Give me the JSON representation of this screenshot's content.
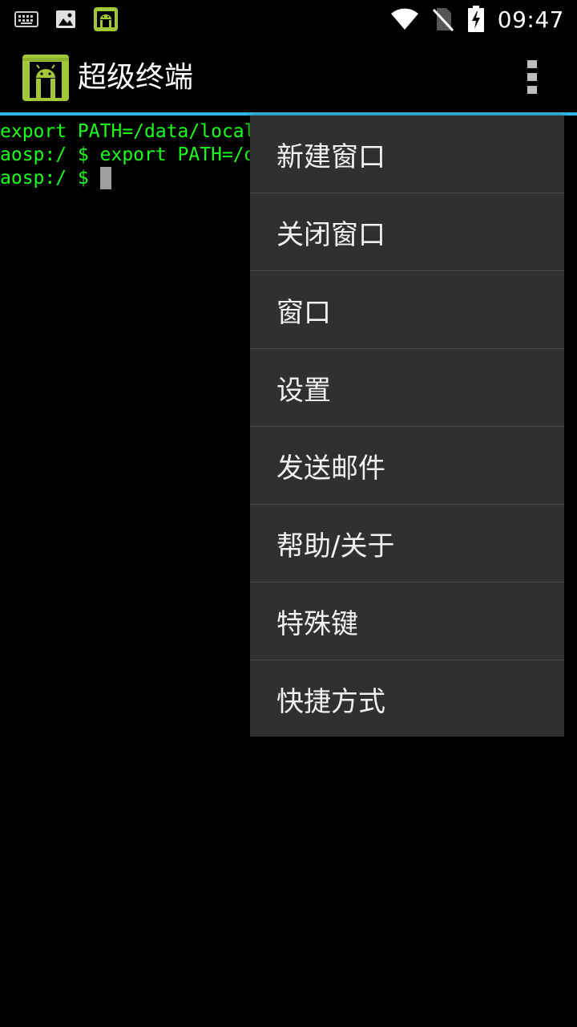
{
  "status_bar": {
    "time": "09:47",
    "left_icons": [
      "keyboard-icon",
      "image-icon",
      "android-notification-icon"
    ],
    "right_icons": [
      "wifi-icon",
      "no-sim-icon",
      "battery-charging-icon"
    ]
  },
  "action_bar": {
    "title": "超级终端",
    "overflow_icon": "overflow-menu-icon"
  },
  "terminal": {
    "lines": [
      "export PATH=/data/local",
      "aosp:/ $ export PATH=/d",
      "aosp:/ $ "
    ],
    "text_color": "#19ff19"
  },
  "menu": {
    "items": [
      {
        "label": "新建窗口"
      },
      {
        "label": "关闭窗口"
      },
      {
        "label": "窗口"
      },
      {
        "label": "设置"
      },
      {
        "label": "发送邮件"
      },
      {
        "label": "帮助/关于"
      },
      {
        "label": "特殊键"
      },
      {
        "label": "快捷方式"
      }
    ]
  },
  "colors": {
    "accent": "#33b5e5",
    "menu_bg": "#303030",
    "app_icon_green": "#a4c639"
  }
}
